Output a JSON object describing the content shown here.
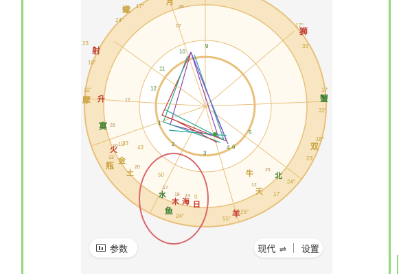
{
  "colors": {
    "ring_outer": "#f3d9a6",
    "ring_line": "#e8c07a",
    "accent_red": "#d1453b",
    "accent_green": "#3a9e3a",
    "circle_annotation": "#d9666a"
  },
  "signs": [
    {
      "label": "蠍",
      "color": "#c9a23c"
    },
    {
      "label": "射",
      "color": "#c0392b"
    },
    {
      "label": "摩",
      "color": "#c9a23c"
    },
    {
      "label": "寞",
      "color": "#3a7d2d"
    },
    {
      "label": "瓶",
      "color": "#c9a23c"
    },
    {
      "label": "鱼",
      "color": "#3a7d2d"
    },
    {
      "label": "羊",
      "color": "#c0392b"
    },
    {
      "label": "双",
      "color": "#c9a23c"
    },
    {
      "label": "蟹",
      "color": "#3a7d2d"
    },
    {
      "label": "狮",
      "color": "#c0392b"
    }
  ],
  "degree_labels": [
    "24°",
    "17°",
    "23",
    "16°",
    "32'",
    "10",
    "43",
    "50",
    "24°",
    "55°",
    "26°",
    "24°",
    "33'",
    "17°",
    "32'",
    "18°",
    "23'",
    "17'",
    "33",
    "17'",
    "0"
  ],
  "houses": [
    "9",
    "10",
    "11",
    "12",
    "1",
    "2",
    "3",
    "4",
    "5",
    "6"
  ],
  "planets": [
    {
      "label": "月",
      "color": "#c9a23c"
    },
    {
      "label": "升",
      "color": "#c0392b"
    },
    {
      "label": "火",
      "color": "#c0392b"
    },
    {
      "label": "金",
      "color": "#c9a23c"
    },
    {
      "label": "土",
      "color": "#c9a23c"
    },
    {
      "label": "水",
      "color": "#3a7d2d"
    },
    {
      "label": "木",
      "color": "#c0392b"
    },
    {
      "label": "海",
      "color": "#c0392b"
    },
    {
      "label": "日",
      "color": "#c0392b"
    },
    {
      "label": "天",
      "color": "#c9a23c"
    },
    {
      "label": "北",
      "color": "#3a7d2d"
    },
    {
      "label": "牛",
      "color": "#c9a23c"
    }
  ],
  "small_numbers": [
    "26",
    "07",
    "28",
    "13",
    "20",
    "12",
    "17",
    "18",
    "23",
    "25",
    "10",
    "12"
  ],
  "toolbar": {
    "params_label": "参数",
    "mode_label": "现代",
    "mode_swap_icon": "⇌",
    "settings_label": "设置"
  }
}
